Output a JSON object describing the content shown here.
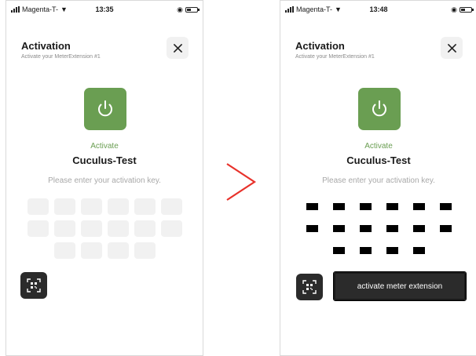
{
  "status_left": {
    "carrier": "Magenta-T-",
    "time": "13:35"
  },
  "status_right": {
    "carrier": "Magenta-T-",
    "time": "13:48"
  },
  "screen": {
    "title": "Activation",
    "subtitle": "Activate your MeterExtension #1",
    "activate_label": "Activate",
    "device_name": "Cuculus-Test",
    "prompt": "Please enter your activation key."
  },
  "key_rows": [
    6,
    6,
    4
  ],
  "right_button": {
    "label": "activate meter extension"
  },
  "colors": {
    "accent_green": "#6a9e52",
    "dark_button": "#2b2b2b",
    "empty_box": "#f1f1f1",
    "arrow": "#e8322b"
  },
  "icons": {
    "close": "close-icon",
    "power": "power-icon",
    "qr": "qr-scan-icon",
    "arrow": "chevron-right-icon"
  }
}
